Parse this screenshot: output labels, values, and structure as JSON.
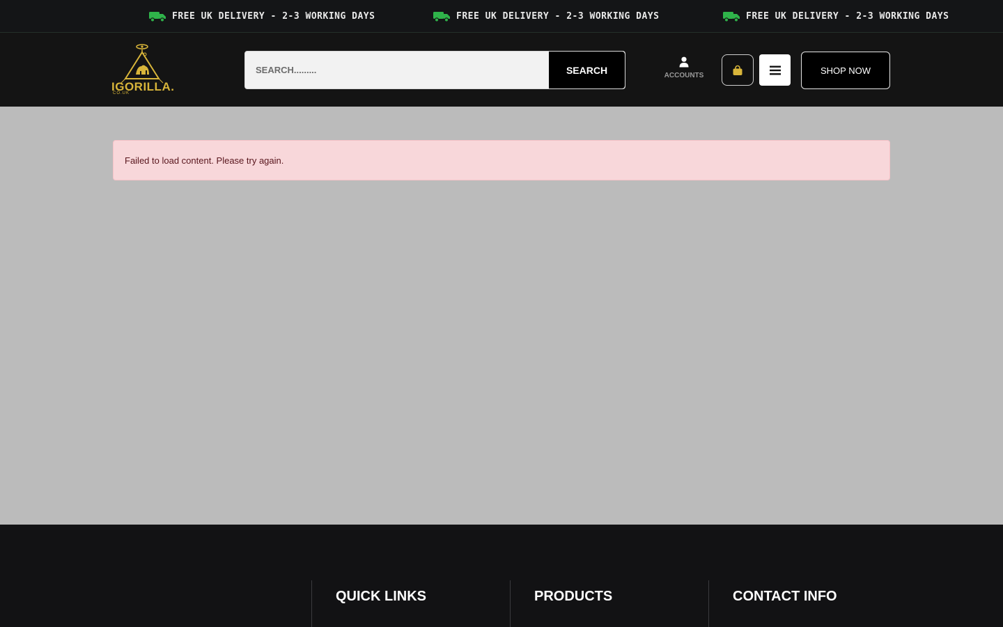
{
  "topbar": {
    "promos": [
      "FREE UK DELIVERY - 2-3 WORKING DAYS",
      "FREE UK DELIVERY - 2-3 WORKING DAYS",
      "FREE UK DELIVERY - 2-3 WORKING DAYS"
    ],
    "icon": "truck-icon",
    "icon_color": "#2fb34a"
  },
  "header": {
    "logo_text": "IGORILLA.",
    "logo_sub": "CO.UK",
    "search": {
      "placeholder": "SEARCH.........",
      "value": "",
      "button_label": "SEARCH"
    },
    "account_label": "ACCOUNTS",
    "cart_icon": "shopping-bag-icon",
    "menu_icon": "hamburger-menu-icon",
    "shop_now_label": "SHOP NOW",
    "accent_color": "#d8b53a"
  },
  "main": {
    "alert_message": "Failed to load content. Please try again."
  },
  "footer": {
    "columns": [
      {
        "heading": "QUICK LINKS"
      },
      {
        "heading": "PRODUCTS"
      },
      {
        "heading": "CONTACT INFO"
      }
    ]
  }
}
